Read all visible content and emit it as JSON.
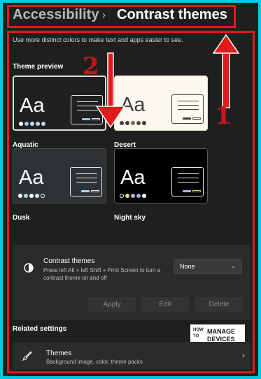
{
  "breadcrumb": {
    "parent": "Accessibility",
    "separator": "›",
    "current": "Contrast themes"
  },
  "description": "Use more distinct colors to make text and apps easier to see.",
  "theme_preview_label": "Theme preview",
  "themes": [
    {
      "name": "Aquatic",
      "sample": "Aa",
      "bg": "#202020",
      "fg": "#ffffff",
      "accent": "#8ad0e8"
    },
    {
      "name": "Desert",
      "sample": "Aa",
      "bg": "#fffaef",
      "fg": "#3d3d3d",
      "accent": "#3d3d3d"
    },
    {
      "name": "Dusk",
      "sample": "Aa",
      "bg": "#2d3236",
      "fg": "#ffffff",
      "accent": "#a8d8f0"
    },
    {
      "name": "Night sky",
      "sample": "Aa",
      "bg": "#000000",
      "fg": "#ffffff",
      "accent": "#c8a8f0"
    }
  ],
  "contrast_setting": {
    "title": "Contrast themes",
    "description": "Press left Alt + left Shift + Print Screen to turn a contrast theme on and off",
    "selected": "None"
  },
  "buttons": {
    "apply": "Apply",
    "edit": "Edit",
    "delete": "Delete"
  },
  "related_settings_label": "Related settings",
  "related_item": {
    "title": "Themes",
    "subtitle": "Background image, color, theme packs"
  },
  "watermark": {
    "how": "HOW",
    "to": "TO",
    "manage": "MANAGE",
    "devices": "DEVICES"
  },
  "annotations": [
    "1",
    "2"
  ],
  "colors": {
    "annotation_red": "#e01b1b",
    "page_bg": "#1f1f1f",
    "border": "#00c8e8"
  }
}
